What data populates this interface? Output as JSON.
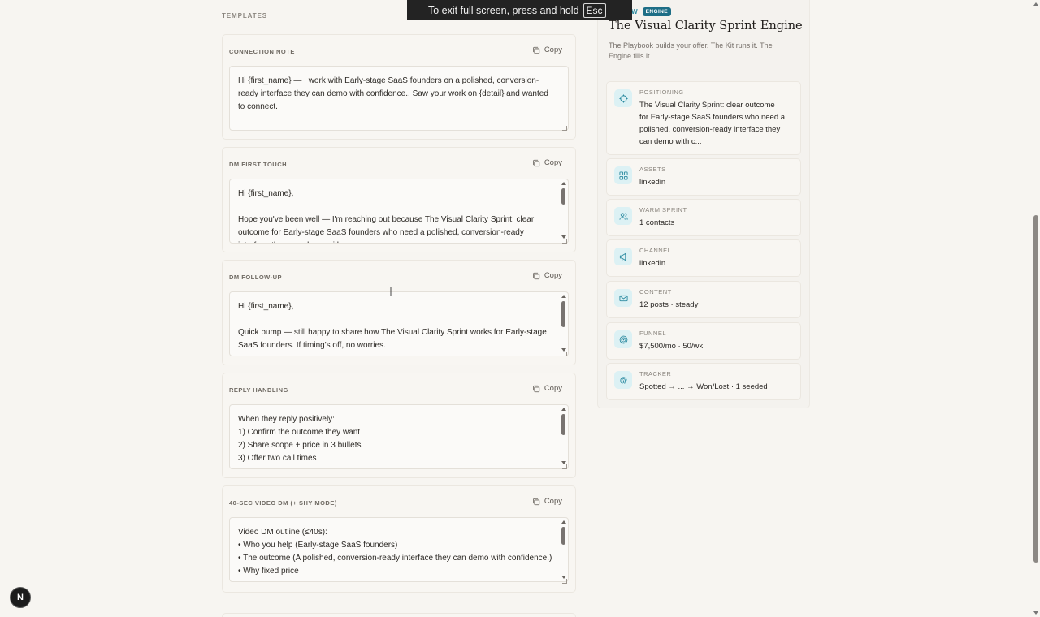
{
  "section_label": "TEMPLATES",
  "templates": [
    {
      "title": "CONNECTION NOTE",
      "copy_label": "Copy",
      "body": "Hi {first_name} — I work with Early-stage SaaS founders on a polished, conversion-ready interface they can demo with confidence.. Saw your work on {detail} and wanted to connect."
    },
    {
      "title": "DM FIRST TOUCH",
      "copy_label": "Copy",
      "body": "Hi {first_name},\n\nHope you've been well — I'm reaching out because The Visual Clarity Sprint: clear outcome for Early-stage SaaS founders who need a polished, conversion-ready interface they can demo with c..."
    },
    {
      "title": "DM FOLLOW-UP",
      "copy_label": "Copy",
      "body": "Hi {first_name},\n\nQuick bump — still happy to share how The Visual Clarity Sprint works for Early-stage SaaS founders. If timing's off, no worries."
    },
    {
      "title": "REPLY HANDLING",
      "copy_label": "Copy",
      "body": "When they reply positively:\n1) Confirm the outcome they want\n2) Share scope + price in 3 bullets\n3) Offer two call times"
    },
    {
      "title": "40-SEC VIDEO DM (+ SHY MODE)",
      "copy_label": "Copy",
      "body": "Video DM outline (≤40s):\n• Who you help (Early-stage SaaS founders)\n• The outcome (A polished, conversion-ready interface they can demo with confidence.)\n• Why fixed price"
    }
  ],
  "panel": {
    "flow_label": "T FLOW",
    "badge": "ENGINE",
    "title": "The Visual Clarity Sprint Engine",
    "subtitle": "The Playbook builds your offer. The Kit runs it. The Engine fills it.",
    "steps": [
      {
        "label": "POSITIONING",
        "value": "The Visual Clarity Sprint: clear outcome for Early-stage SaaS founders who need a polished, conversion-ready interface they can demo with c...",
        "icon": "target-icon"
      },
      {
        "label": "ASSETS",
        "value": "linkedin",
        "icon": "grid-icon"
      },
      {
        "label": "WARM SPRINT",
        "value": "1 contacts",
        "icon": "users-icon"
      },
      {
        "label": "CHANNEL",
        "value": "linkedin",
        "icon": "megaphone-icon"
      },
      {
        "label": "CONTENT",
        "value": "12 posts · steady",
        "icon": "mail-icon"
      },
      {
        "label": "FUNNEL",
        "value": "$7,500/mo · 50/wk",
        "icon": "bullseye-icon"
      },
      {
        "label": "TRACKER",
        "value": "Spotted → ... → Won/Lost · 1 seeded",
        "icon": "fingerprint-icon"
      }
    ]
  },
  "fullscreen_banner": {
    "text": "To exit full screen, press and hold",
    "key": "Esc"
  },
  "dev_badge": "N",
  "colors": {
    "accent": "#2b8aa0",
    "badge_bg": "#1e6e86",
    "page_bg": "#f7f5f1"
  }
}
